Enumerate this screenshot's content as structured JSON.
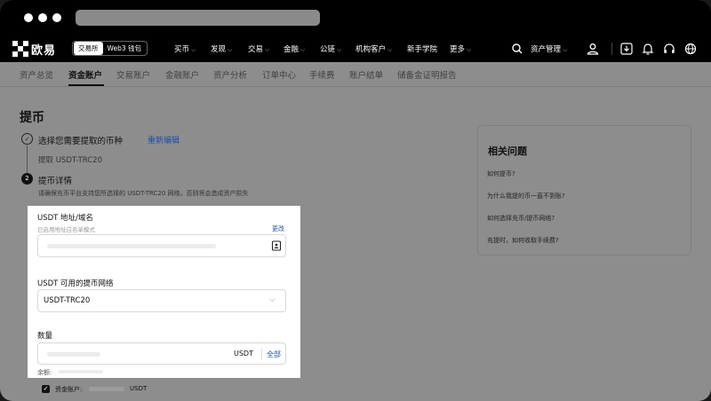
{
  "nav": {
    "logo_text": "欧易",
    "mode_exchange": "交易所",
    "mode_web3": "Web3 钱包",
    "items": [
      "买币",
      "发现",
      "交易",
      "金融",
      "公链",
      "机构客户",
      "新手学院",
      "更多"
    ],
    "asset_mgmt": "资产管理"
  },
  "subtabs": [
    "资产总览",
    "资金账户",
    "交易账户",
    "金融账户",
    "资产分析",
    "订单中心",
    "手续费",
    "账户结单",
    "储备金证明报告"
  ],
  "page": {
    "title": "提币",
    "step1_num": "✓",
    "step1_title": "选择您需要提取的币种",
    "step1_edit": "重新编辑",
    "step1_selected": "提取 USDT-TRC20",
    "step2_num": "2",
    "step2_title": "提币详情",
    "step2_desc": "请确保充币平台支持您所选择的 USDT-TRC20 网络，否则将会造成资产损失"
  },
  "form": {
    "address_label": "USDT 地址/域名",
    "address_hint": "已启用地址白名单模式",
    "address_change": "更改",
    "network_label": "USDT 可用的提币网络",
    "network_value": "USDT-TRC20",
    "amount_label": "数量",
    "amount_unit": "USDT",
    "amount_all": "全部",
    "balance_label": "余额:",
    "funding_label": "资金账户:",
    "funding_unit": "USDT"
  },
  "faq": {
    "title": "相关问题",
    "items": [
      "如何提币?",
      "为什么我提的币一直不到账?",
      "如何选择充币/提币网络?",
      "充提时，如何收取手续费?"
    ]
  }
}
